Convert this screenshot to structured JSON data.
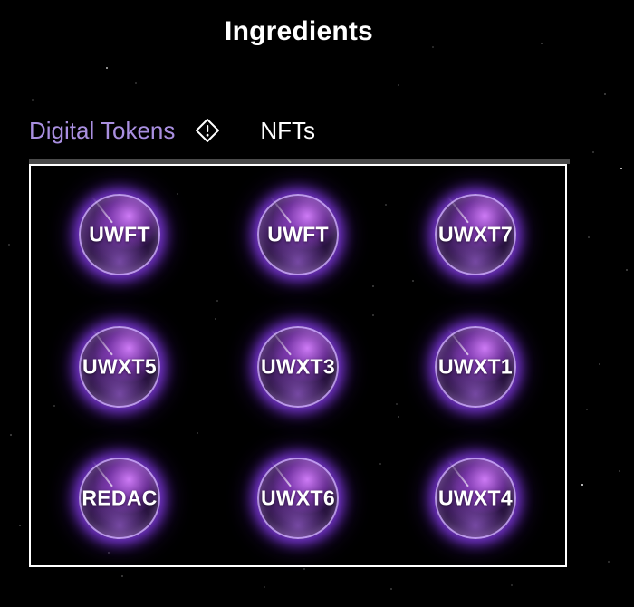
{
  "header": {
    "title": "Ingredients"
  },
  "tabs": [
    {
      "label": "Digital Tokens",
      "active": true,
      "icon": "warning-diamond-icon"
    },
    {
      "label": "NFTs",
      "active": false
    }
  ],
  "colors": {
    "accent": "#a98fe0",
    "background": "#000000",
    "glow": "#9646ff"
  },
  "tokens": [
    {
      "label": "UWFT"
    },
    {
      "label": "UWFT"
    },
    {
      "label": "UWXT7"
    },
    {
      "label": "UWXT5"
    },
    {
      "label": "UWXT3"
    },
    {
      "label": "UWXT1"
    },
    {
      "label": "REDAC"
    },
    {
      "label": "UWXT6"
    },
    {
      "label": "UWXT4"
    }
  ]
}
